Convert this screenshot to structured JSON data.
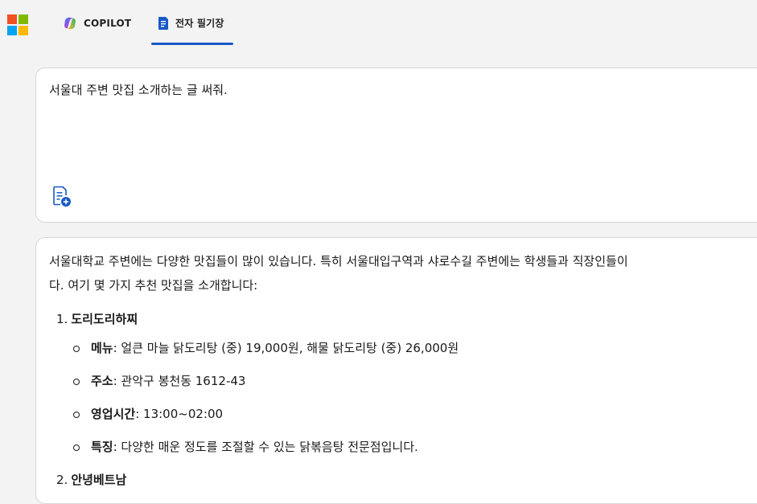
{
  "tabs": [
    {
      "label": "COPILOT"
    },
    {
      "label": "전자 필기장"
    }
  ],
  "prompt": {
    "text": "서울대 주변 맛집 소개하는 글 써줘."
  },
  "answer": {
    "intro_line1": "서울대학교 주변에는 다양한 맛집들이 많이 있습니다. 특히 서울대입구역과 샤로수길 주변에는 학생들과 직장인들이",
    "intro_line2": "다. 여기 몇 가지 추천 맛집을 소개합니다:",
    "items": [
      {
        "num": "1.",
        "title": "도리도리하찌",
        "details": [
          {
            "key": "메뉴",
            "value": ": 얼큰 마늘 닭도리탕 (중) 19,000원, 해물 닭도리탕 (중) 26,000원"
          },
          {
            "key": "주소",
            "value": ": 관악구 봉천동 1612-43"
          },
          {
            "key": "영업시간",
            "value": ": 13:00~02:00"
          },
          {
            "key": "특징",
            "value": ": 다양한 매운 정도를 조절할 수 있는 닭볶음탕 전문점입니다."
          }
        ]
      },
      {
        "num": "2.",
        "title": "안녕베트남"
      }
    ]
  },
  "colors": {
    "accent": "#1659c7",
    "background": "#f3f3f3",
    "card": "#ffffff"
  },
  "icons": [
    "microsoft-logo-icon",
    "copilot-icon",
    "notebook-icon",
    "add-note-icon"
  ]
}
